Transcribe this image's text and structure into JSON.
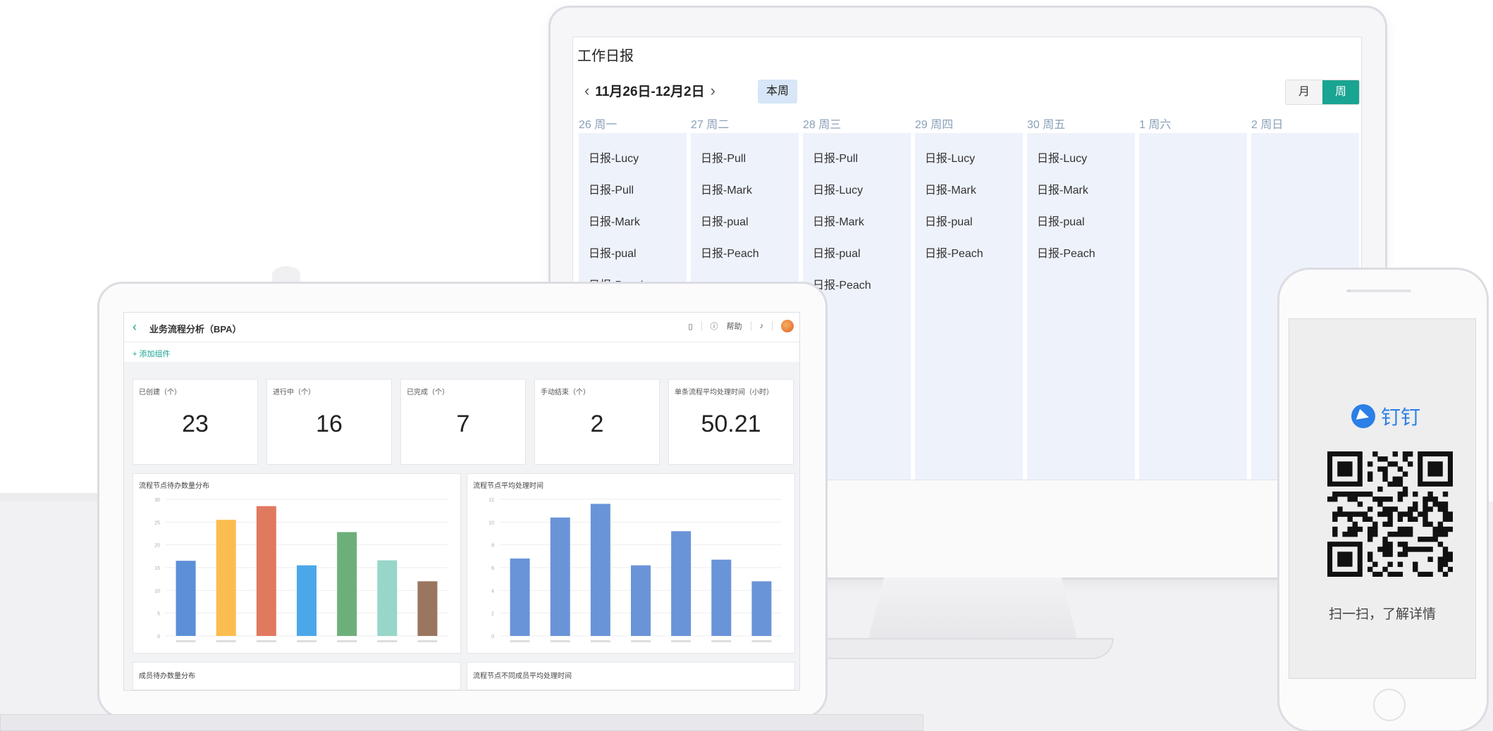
{
  "calendar": {
    "title": "工作日报",
    "range": "11月26日-12月2日",
    "prev_icon": "chevron-left",
    "next_icon": "chevron-right",
    "this_week": "本周",
    "view_month": "月",
    "view_week": "周",
    "days": [
      {
        "head": "26 周一",
        "items": [
          "日报-Lucy",
          "日报-Pull",
          "日报-Mark",
          "日报-pual",
          "日报-Peach"
        ]
      },
      {
        "head": "27 周二",
        "items": [
          "日报-Pull",
          "日报-Mark",
          "日报-pual",
          "日报-Peach"
        ]
      },
      {
        "head": "28 周三",
        "items": [
          "日报-Pull",
          "日报-Lucy",
          "日报-Mark",
          "日报-pual",
          "日报-Peach"
        ]
      },
      {
        "head": "29 周四",
        "items": [
          "日报-Lucy",
          "日报-Mark",
          "日报-pual",
          "日报-Peach"
        ]
      },
      {
        "head": "30 周五",
        "items": [
          "日报-Lucy",
          "日报-Mark",
          "日报-pual",
          "日报-Peach"
        ]
      },
      {
        "head": "1 周六",
        "items": []
      },
      {
        "head": "2 周日",
        "items": []
      }
    ],
    "accent": "#1aa492"
  },
  "bpa": {
    "title": "业务流程分析（BPA）",
    "help": "帮助",
    "add_component": "+ 添加组件",
    "stats": [
      {
        "label": "已创建（个）",
        "value": "23"
      },
      {
        "label": "进行中（个）",
        "value": "16"
      },
      {
        "label": "已完成（个）",
        "value": "7"
      },
      {
        "label": "手动结束（个）",
        "value": "2"
      },
      {
        "label": "单条流程平均处理时间（小时）",
        "value": "50.21"
      }
    ],
    "panel_titles": [
      "流程节点待办数量分布",
      "流程节点平均处理时间"
    ],
    "bottom_titles": [
      "成员待办数量分布",
      "流程节点不同成员平均处理时间"
    ]
  },
  "chart_data": [
    {
      "type": "bar",
      "title": "流程节点待办数量分布",
      "values": [
        16.5,
        25.5,
        28.5,
        15.5,
        22.8,
        16.6,
        12
      ],
      "ylim": [
        0,
        30
      ],
      "yticks": [
        0,
        5,
        10,
        15,
        20,
        25,
        30
      ],
      "colors": [
        "#5b8fd8",
        "#fbbd4f",
        "#e07a5f",
        "#4ba8e8",
        "#6daf7a",
        "#97d6c8",
        "#9a7560"
      ]
    },
    {
      "type": "bar",
      "title": "流程节点平均处理时间",
      "values": [
        6.8,
        10.4,
        11.6,
        6.2,
        9.2,
        6.7,
        4.8
      ],
      "ylim": [
        0,
        12
      ],
      "yticks": [
        0,
        2,
        4,
        6,
        8,
        10,
        12
      ],
      "colors": [
        "#6a94d8",
        "#6a94d8",
        "#6a94d8",
        "#6a94d8",
        "#6a94d8",
        "#6a94d8",
        "#6a94d8"
      ]
    }
  ],
  "phone": {
    "brand": "钉钉",
    "scan_text": "扫一扫，了解详情"
  }
}
